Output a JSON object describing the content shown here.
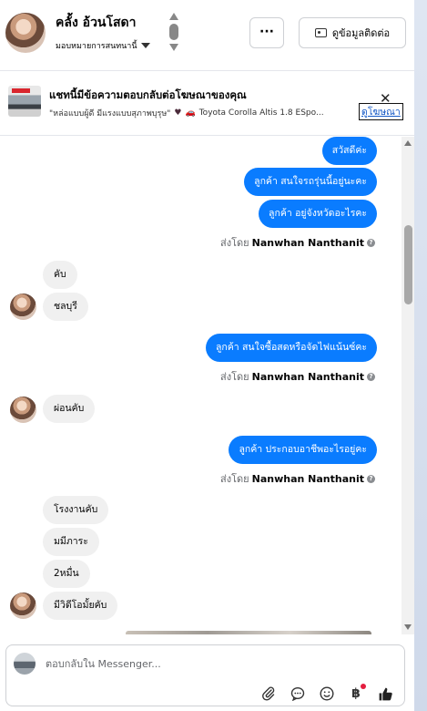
{
  "header": {
    "contact_name": "คลั้ง อ้วนโสดา",
    "assign_label": "มอบหมายการสนทนานี้",
    "more_label": "···",
    "contact_info_label": "ดูข้อมูลติดต่อ"
  },
  "ad": {
    "title": "แชทนี้มีข้อความตอบกลับต่อโฆษณาของคุณ",
    "quote": "\"หล่อแบบผู้ดี มีแรงแบบสุภาพบุรุษ\"",
    "car": "Toyota Corolla Altis 1.8 ESpo...",
    "link_label": "ดูโฆษณา"
  },
  "messages": {
    "out1": "สวัสดีค่ะ",
    "out2": "ลูกค้า  สนใจรถรุ่นนี้อยู่นะคะ",
    "out3": "ลูกค้า  อยู่จังหวัดอะไรคะ",
    "sent_prefix": "ส่งโดย",
    "sender": "Nanwhan Nanthanit",
    "in1": "คับ",
    "in2": "ชลบุรี",
    "out4": "ลูกค้า  สนใจซื้อสดหรือจัดไฟแน้นซ์คะ",
    "in3": "ผ่อนคับ",
    "out5": "ลูกค้า ประกอบอาชีพอะไรอยู่คะ",
    "in4": "โรงงานคับ",
    "in5": "มมีภาระ",
    "in6": "2หมื่น",
    "in7": "มีวิดีโอมั้ยคับ"
  },
  "composer": {
    "placeholder": "ตอบกลับใน Messenger..."
  },
  "icons": {
    "attach": "paperclip-icon",
    "chat": "chat-bubble-icon",
    "emoji": "smile-icon",
    "currency": "baht-icon",
    "like": "thumbs-up-icon"
  },
  "colors": {
    "outgoing": "#0a7cff",
    "incoming": "#f0f0f0"
  }
}
